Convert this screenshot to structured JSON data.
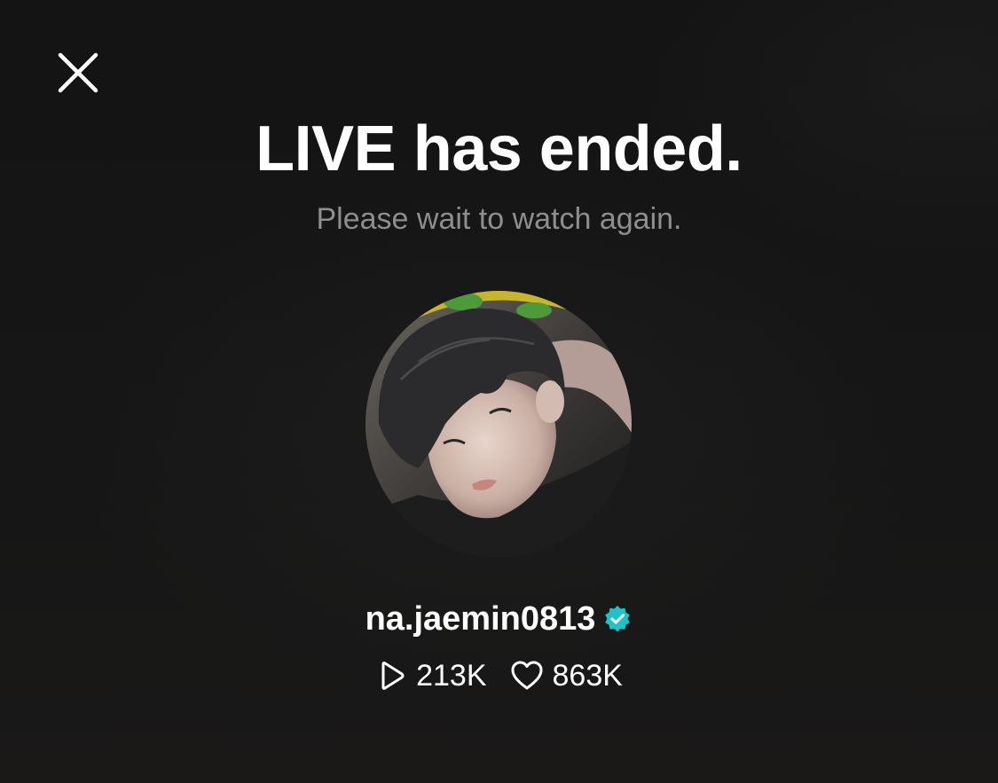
{
  "close": {
    "icon": "close-icon"
  },
  "title": "LIVE has ended.",
  "subtitle": "Please wait to watch again.",
  "profile": {
    "username": "na.jaemin0813",
    "verified": true,
    "verified_color": "#1ec2c9",
    "avatar_icon": "profile-photo"
  },
  "stats": {
    "plays": "213K",
    "plays_icon": "play-icon",
    "likes": "863K",
    "likes_icon": "heart-icon"
  },
  "colors": {
    "background": "#151515",
    "subtitle": "#8e8e8e",
    "text": "#ffffff"
  }
}
